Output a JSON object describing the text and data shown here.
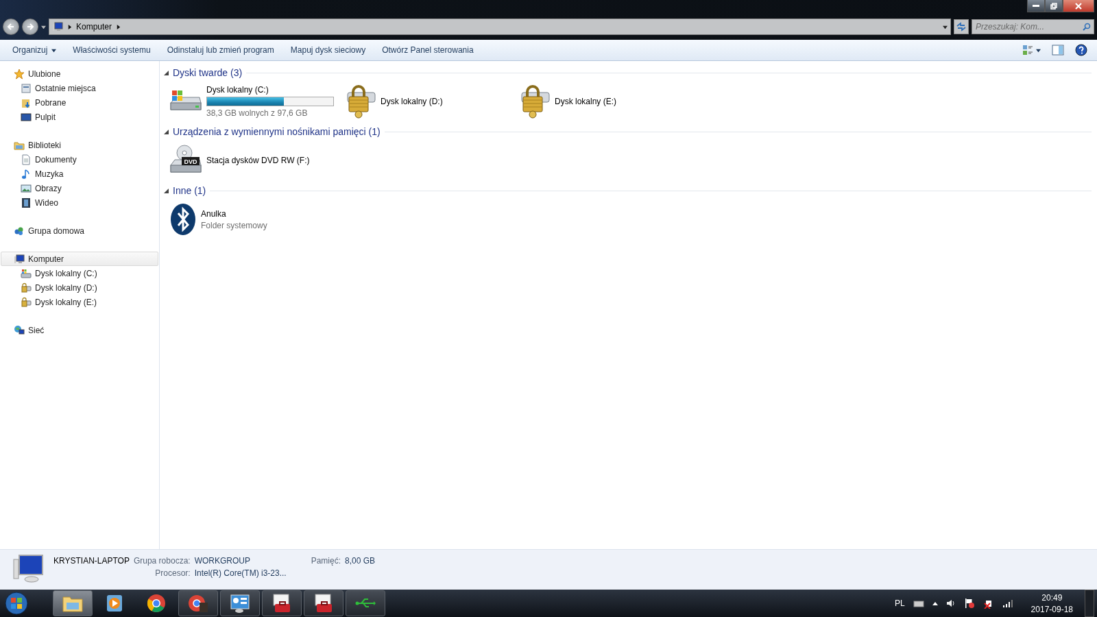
{
  "address_bar": {
    "breadcrumb": [
      "Komputer"
    ],
    "search": {
      "placeholder": "Przeszukaj: Kom..."
    }
  },
  "toolbar": {
    "items": [
      {
        "label": "Organizuj",
        "dropdown": true
      },
      {
        "label": "Właściwości systemu",
        "dropdown": false
      },
      {
        "label": "Odinstaluj lub zmień program",
        "dropdown": false
      },
      {
        "label": "Mapuj dysk sieciowy",
        "dropdown": false
      },
      {
        "label": "Otwórz Panel sterowania",
        "dropdown": false
      }
    ]
  },
  "sidebar": {
    "groups": [
      {
        "label": "Ulubione",
        "kind": "star",
        "selected": false,
        "children": [
          {
            "label": "Ostatnie miejsca",
            "kind": "recent",
            "selected": false
          },
          {
            "label": "Pobrane",
            "kind": "download",
            "selected": false
          },
          {
            "label": "Pulpit",
            "kind": "desktop",
            "selected": false
          }
        ]
      },
      {
        "label": "Biblioteki",
        "kind": "library",
        "selected": false,
        "children": [
          {
            "label": "Dokumenty",
            "kind": "document",
            "selected": false
          },
          {
            "label": "Muzyka",
            "kind": "music",
            "selected": false
          },
          {
            "label": "Obrazy",
            "kind": "picture",
            "selected": false
          },
          {
            "label": "Wideo",
            "kind": "video",
            "selected": false
          }
        ]
      },
      {
        "label": "Grupa domowa",
        "kind": "homegroup",
        "selected": false
      },
      {
        "label": "Komputer",
        "kind": "computer",
        "selected": true,
        "children": [
          {
            "label": "Dysk lokalny (C:)",
            "kind": "system-drive",
            "selected": false
          },
          {
            "label": "Dysk lokalny (D:)",
            "kind": "locked-drive",
            "selected": false
          },
          {
            "label": "Dysk lokalny (E:)",
            "kind": "locked-drive",
            "selected": false
          }
        ]
      },
      {
        "label": "Sieć",
        "kind": "network",
        "selected": false
      }
    ]
  },
  "sections": [
    {
      "title": "Dyski twarde (3)",
      "expanded": true,
      "items": [
        {
          "kind": "system-drive",
          "name": "Dysk lokalny (C:)",
          "level": 0.61,
          "reading": "38,3 GB wolnych z 97,6 GB"
        },
        {
          "kind": "locked-drive",
          "name": "Dysk lokalny (D:)"
        },
        {
          "kind": "locked-drive",
          "name": "Dysk lokalny (E:)"
        }
      ]
    },
    {
      "title": "Urządzenia z wymiennymi nośnikami pamięci (1)",
      "expanded": true,
      "items": [
        {
          "kind": "dvd",
          "name": "Stacja dysków DVD RW (F:)",
          "badge": "DVD"
        }
      ]
    },
    {
      "title": "Inne (1)",
      "expanded": true,
      "items": [
        {
          "kind": "bluetooth",
          "name": "Anulka",
          "subtitle": "Folder systemowy"
        }
      ]
    }
  ],
  "details": {
    "name": "KRYSTIAN-LAPTOP",
    "fields": [
      {
        "label": "Grupa robocza:",
        "value": "WORKGROUP"
      },
      {
        "label": "Pamięć:",
        "value": "8,00 GB"
      },
      {
        "label": "Procesor:",
        "value": "Intel(R) Core(TM) i3-23..."
      }
    ]
  },
  "taskbar": {
    "apps": [
      {
        "kind": "explorer",
        "running": true,
        "selected": true
      },
      {
        "kind": "media",
        "running": false,
        "selected": false
      },
      {
        "kind": "chrome",
        "running": false,
        "selected": false
      },
      {
        "kind": "chrome-photo",
        "running": true,
        "selected": false
      },
      {
        "kind": "control-panel",
        "running": true,
        "selected": false
      },
      {
        "kind": "toolbox",
        "running": true,
        "selected": false
      },
      {
        "kind": "toolbox",
        "running": true,
        "selected": false
      },
      {
        "kind": "usb",
        "running": true,
        "selected": false
      }
    ],
    "language": "PL",
    "time": "20:49",
    "date": "2017-09-18"
  }
}
